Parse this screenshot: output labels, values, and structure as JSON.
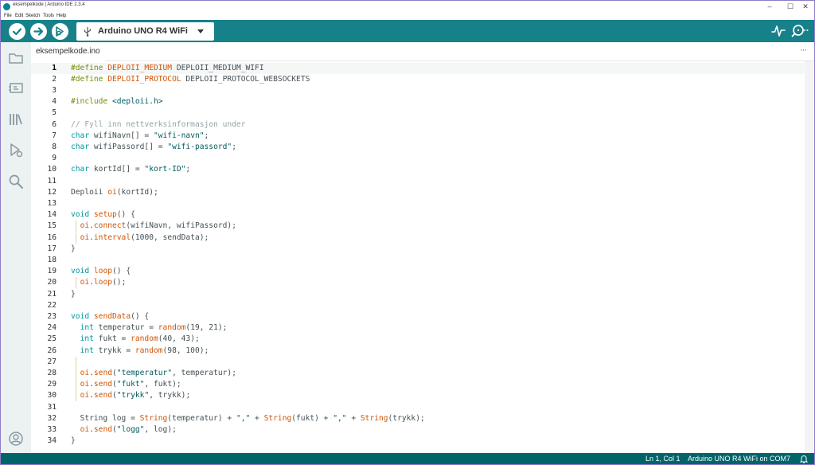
{
  "window": {
    "title": "eksempelkode | Arduino IDE 2.3.4",
    "minimize_glyph": "–",
    "maximize_glyph": "☐",
    "close_glyph": "✕"
  },
  "menu": [
    "File",
    "Edit",
    "Sketch",
    "Tools",
    "Help"
  ],
  "toolbar": {
    "verify_icon": "check-icon",
    "upload_icon": "arrow-right-icon",
    "debug_icon": "debug-icon",
    "board_label": "Arduino UNO R4 WiFi",
    "serial_plotter_icon": "pulse-icon",
    "serial_monitor_icon": "magnifier-dots-icon"
  },
  "sidebar": [
    "folder-icon",
    "board-manager-icon",
    "library-icon",
    "debug-icon",
    "search-icon",
    "account-icon"
  ],
  "tab": {
    "filename": "eksempelkode.ino",
    "more": "···"
  },
  "code": [
    {
      "n": "1",
      "t": [
        [
          "pp",
          "#define "
        ],
        [
          "id",
          "DEPLOII_MEDIUM"
        ],
        [
          "plain",
          " DEPLOII_MEDIUM_WIFI"
        ]
      ]
    },
    {
      "n": "2",
      "t": [
        [
          "pp",
          "#define "
        ],
        [
          "id",
          "DEPLOII_PROTOCOL"
        ],
        [
          "plain",
          " DEPLOII_PROTOCOL_WEBSOCKETS"
        ]
      ]
    },
    {
      "n": "3",
      "t": []
    },
    {
      "n": "4",
      "t": [
        [
          "pp",
          "#include "
        ],
        [
          "str",
          "<deploii.h>"
        ]
      ]
    },
    {
      "n": "5",
      "t": []
    },
    {
      "n": "6",
      "t": [
        [
          "cm",
          "// Fyll inn nettverksinformasjon under"
        ]
      ]
    },
    {
      "n": "7",
      "t": [
        [
          "kw",
          "char"
        ],
        [
          "plain",
          " wifiNavn[] = "
        ],
        [
          "str",
          "\"wifi-navn\""
        ],
        [
          "plain",
          ";"
        ]
      ]
    },
    {
      "n": "8",
      "t": [
        [
          "kw",
          "char"
        ],
        [
          "plain",
          " wifiPassord[] = "
        ],
        [
          "str",
          "\"wifi-passord\""
        ],
        [
          "plain",
          ";"
        ]
      ]
    },
    {
      "n": "9",
      "t": []
    },
    {
      "n": "10",
      "t": [
        [
          "kw",
          "char"
        ],
        [
          "plain",
          " kortId[] = "
        ],
        [
          "str",
          "\"kort-ID\""
        ],
        [
          "plain",
          ";"
        ]
      ]
    },
    {
      "n": "11",
      "t": []
    },
    {
      "n": "12",
      "t": [
        [
          "plain",
          "Deploii "
        ],
        [
          "fn",
          "oi"
        ],
        [
          "plain",
          "(kortId);"
        ]
      ]
    },
    {
      "n": "13",
      "t": []
    },
    {
      "n": "14",
      "t": [
        [
          "kw",
          "void"
        ],
        [
          "plain",
          " "
        ],
        [
          "fn",
          "setup"
        ],
        [
          "plain",
          "() {"
        ]
      ]
    },
    {
      "n": "15",
      "g": true,
      "t": [
        [
          "plain",
          "  "
        ],
        [
          "fn",
          "oi"
        ],
        [
          "plain",
          "."
        ],
        [
          "fn",
          "connect"
        ],
        [
          "plain",
          "(wifiNavn, wifiPassord);"
        ]
      ]
    },
    {
      "n": "16",
      "g": true,
      "t": [
        [
          "plain",
          "  "
        ],
        [
          "fn",
          "oi"
        ],
        [
          "plain",
          "."
        ],
        [
          "fn",
          "interval"
        ],
        [
          "plain",
          "(1000, sendData);"
        ]
      ]
    },
    {
      "n": "17",
      "t": [
        [
          "plain",
          "}"
        ]
      ]
    },
    {
      "n": "18",
      "t": []
    },
    {
      "n": "19",
      "t": [
        [
          "kw",
          "void"
        ],
        [
          "plain",
          " "
        ],
        [
          "fn",
          "loop"
        ],
        [
          "plain",
          "() {"
        ]
      ]
    },
    {
      "n": "20",
      "g": true,
      "t": [
        [
          "plain",
          "  "
        ],
        [
          "fn",
          "oi"
        ],
        [
          "plain",
          "."
        ],
        [
          "fn",
          "loop"
        ],
        [
          "plain",
          "();"
        ]
      ]
    },
    {
      "n": "21",
      "t": [
        [
          "plain",
          "}"
        ]
      ]
    },
    {
      "n": "22",
      "t": []
    },
    {
      "n": "23",
      "t": [
        [
          "kw",
          "void"
        ],
        [
          "plain",
          " "
        ],
        [
          "fn",
          "sendData"
        ],
        [
          "plain",
          "() {"
        ]
      ]
    },
    {
      "n": "24",
      "t": [
        [
          "plain",
          "  "
        ],
        [
          "kw",
          "int"
        ],
        [
          "plain",
          " temperatur = "
        ],
        [
          "fn",
          "random"
        ],
        [
          "plain",
          "(19, 21);"
        ]
      ]
    },
    {
      "n": "25",
      "t": [
        [
          "plain",
          "  "
        ],
        [
          "kw",
          "int"
        ],
        [
          "plain",
          " fukt = "
        ],
        [
          "fn",
          "random"
        ],
        [
          "plain",
          "(40, 43);"
        ]
      ]
    },
    {
      "n": "26",
      "t": [
        [
          "plain",
          "  "
        ],
        [
          "kw",
          "int"
        ],
        [
          "plain",
          " trykk = "
        ],
        [
          "fn",
          "random"
        ],
        [
          "plain",
          "(98, 100);"
        ]
      ]
    },
    {
      "n": "27",
      "g": true,
      "t": []
    },
    {
      "n": "28",
      "g": true,
      "t": [
        [
          "plain",
          "  "
        ],
        [
          "fn",
          "oi"
        ],
        [
          "plain",
          "."
        ],
        [
          "fn",
          "send"
        ],
        [
          "plain",
          "("
        ],
        [
          "str",
          "\"temperatur\""
        ],
        [
          "plain",
          ", temperatur);"
        ]
      ]
    },
    {
      "n": "29",
      "g": true,
      "t": [
        [
          "plain",
          "  "
        ],
        [
          "fn",
          "oi"
        ],
        [
          "plain",
          "."
        ],
        [
          "fn",
          "send"
        ],
        [
          "plain",
          "("
        ],
        [
          "str",
          "\"fukt\""
        ],
        [
          "plain",
          ", fukt);"
        ]
      ]
    },
    {
      "n": "30",
      "g": true,
      "t": [
        [
          "plain",
          "  "
        ],
        [
          "fn",
          "oi"
        ],
        [
          "plain",
          "."
        ],
        [
          "fn",
          "send"
        ],
        [
          "plain",
          "("
        ],
        [
          "str",
          "\"trykk\""
        ],
        [
          "plain",
          ", trykk);"
        ]
      ]
    },
    {
      "n": "31",
      "t": []
    },
    {
      "n": "32",
      "t": [
        [
          "plain",
          "  String log = "
        ],
        [
          "fn",
          "String"
        ],
        [
          "plain",
          "(temperatur) + "
        ],
        [
          "str",
          "\",\""
        ],
        [
          "plain",
          " + "
        ],
        [
          "fn",
          "String"
        ],
        [
          "plain",
          "(fukt) + "
        ],
        [
          "str",
          "\",\""
        ],
        [
          "plain",
          " + "
        ],
        [
          "fn",
          "String"
        ],
        [
          "plain",
          "(trykk);"
        ]
      ]
    },
    {
      "n": "33",
      "t": [
        [
          "plain",
          "  "
        ],
        [
          "fn",
          "oi"
        ],
        [
          "plain",
          "."
        ],
        [
          "fn",
          "send"
        ],
        [
          "plain",
          "("
        ],
        [
          "str",
          "\"logg\""
        ],
        [
          "plain",
          ", log);"
        ]
      ]
    },
    {
      "n": "34",
      "t": [
        [
          "plain",
          "}"
        ]
      ]
    }
  ],
  "status": {
    "position": "Ln 1, Col 1",
    "board_port": "Arduino UNO R4 WiFi on COM7",
    "notification_icon": "bell-icon"
  }
}
